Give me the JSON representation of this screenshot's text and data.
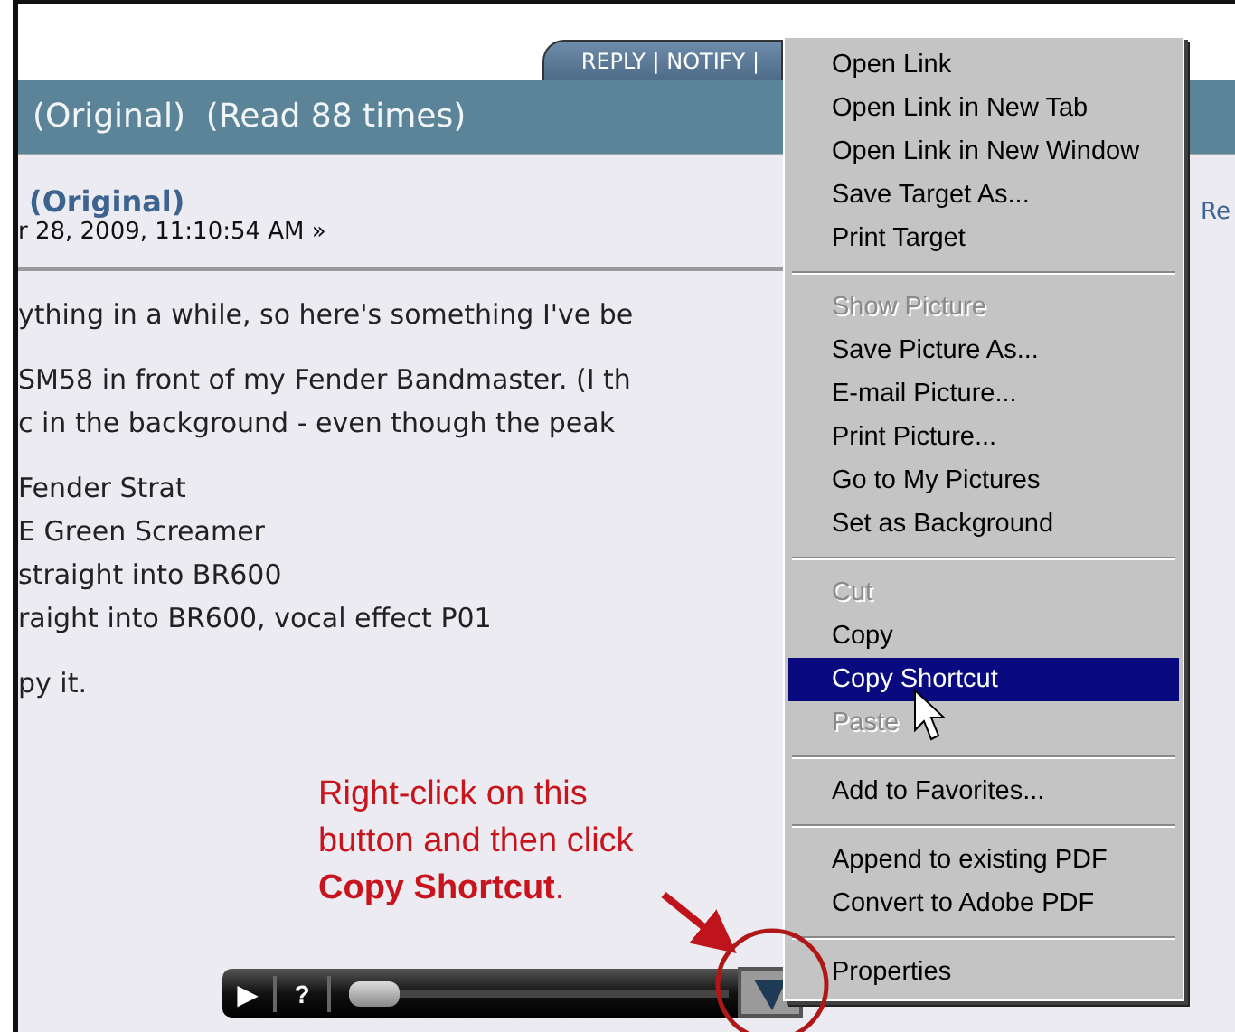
{
  "tab_bar": {
    "label": "REPLY | NOTIFY |"
  },
  "topic_header": {
    "title": "(Original)  (Read 88 times)"
  },
  "post": {
    "author": "(Original)",
    "date": "r 28, 2009, 11:10:54 AM »",
    "side_text": "Re",
    "paragraphs": [
      [
        "ything in a while, so here's something I've be"
      ],
      [
        "SM58 in front of my Fender Bandmaster. (I th",
        "c in the background - even though the peak"
      ],
      [
        "Fender Strat",
        "E Green Screamer",
        "straight into BR600",
        "raight into BR600, vocal effect P01"
      ],
      [
        "py it."
      ]
    ]
  },
  "annotation": {
    "text": "Right-click on this\nbutton and then click\n**Copy Shortcut**."
  },
  "player": {
    "play": "▶",
    "help": "?",
    "level": 0
  },
  "context_menu": {
    "groups": [
      [
        {
          "label": "Open Link",
          "disabled": false,
          "selected": false
        },
        {
          "label": "Open Link in New Tab",
          "disabled": false,
          "selected": false
        },
        {
          "label": "Open Link in New Window",
          "disabled": false,
          "selected": false
        },
        {
          "label": "Save Target As...",
          "disabled": false,
          "selected": false
        },
        {
          "label": "Print Target",
          "disabled": false,
          "selected": false
        }
      ],
      [
        {
          "label": "Show Picture",
          "disabled": true,
          "selected": false
        },
        {
          "label": "Save Picture As...",
          "disabled": false,
          "selected": false
        },
        {
          "label": "E-mail Picture...",
          "disabled": false,
          "selected": false
        },
        {
          "label": "Print Picture...",
          "disabled": false,
          "selected": false
        },
        {
          "label": "Go to My Pictures",
          "disabled": false,
          "selected": false
        },
        {
          "label": "Set as Background",
          "disabled": false,
          "selected": false
        }
      ],
      [
        {
          "label": "Cut",
          "disabled": true,
          "selected": false
        },
        {
          "label": "Copy",
          "disabled": false,
          "selected": false
        },
        {
          "label": "Copy Shortcut",
          "disabled": false,
          "selected": true
        },
        {
          "label": "Paste",
          "disabled": true,
          "selected": false
        }
      ],
      [
        {
          "label": "Add to Favorites...",
          "disabled": false,
          "selected": false
        }
      ],
      [
        {
          "label": "Append to existing PDF",
          "disabled": false,
          "selected": false
        },
        {
          "label": "Convert to Adobe PDF",
          "disabled": false,
          "selected": false
        }
      ],
      [
        {
          "label": "Properties",
          "disabled": false,
          "selected": false
        }
      ]
    ]
  }
}
